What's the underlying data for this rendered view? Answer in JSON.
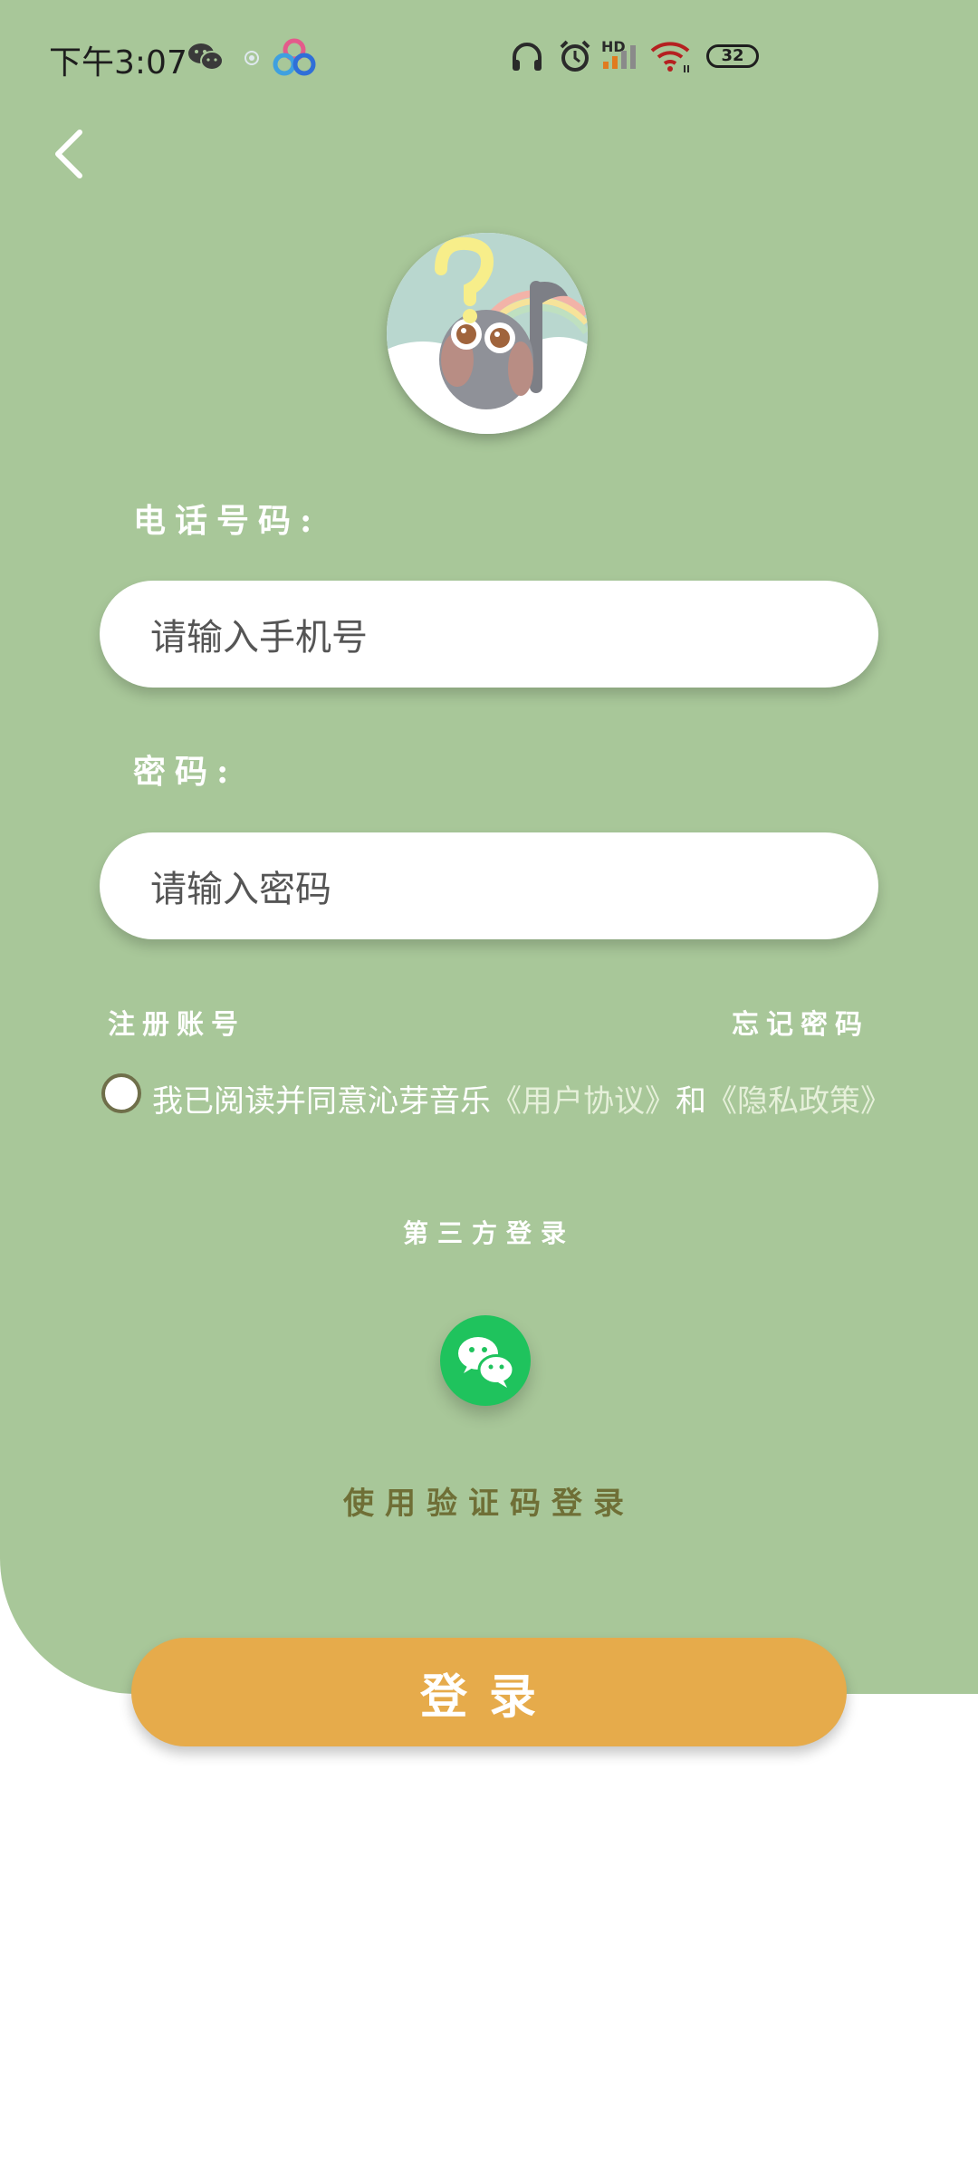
{
  "status_bar": {
    "time": "下午3:07",
    "battery": "32",
    "network_badge": "HD",
    "icons": [
      "wechat-icon",
      "app-notification-icon",
      "cloud-sync-icon",
      "headphones-icon",
      "alarm-icon",
      "signal-icon",
      "wifi-icon",
      "battery-icon"
    ]
  },
  "nav": {
    "back_icon": "chevron-left-icon"
  },
  "form": {
    "phone_label": "电话号码:",
    "phone_placeholder": "请输入手机号",
    "password_label": "密码:",
    "password_placeholder": "请输入密码",
    "register_link": "注册账号",
    "forgot_link": "忘记密码"
  },
  "agreement": {
    "prefix": "我已阅读并同意沁芽音乐",
    "user_agreement": "《用户协议》",
    "and": "和",
    "privacy_policy": "《隐私政策》",
    "checked": false
  },
  "third_party": {
    "title": "第三方登录",
    "wechat_icon": "wechat-icon"
  },
  "code_login": "使用验证码登录",
  "login_button": "登录",
  "colors": {
    "background_green": "#a8c799",
    "login_button": "#e6ab4b",
    "wechat_green": "#1fc35d",
    "code_login_text": "#6f6f36"
  }
}
